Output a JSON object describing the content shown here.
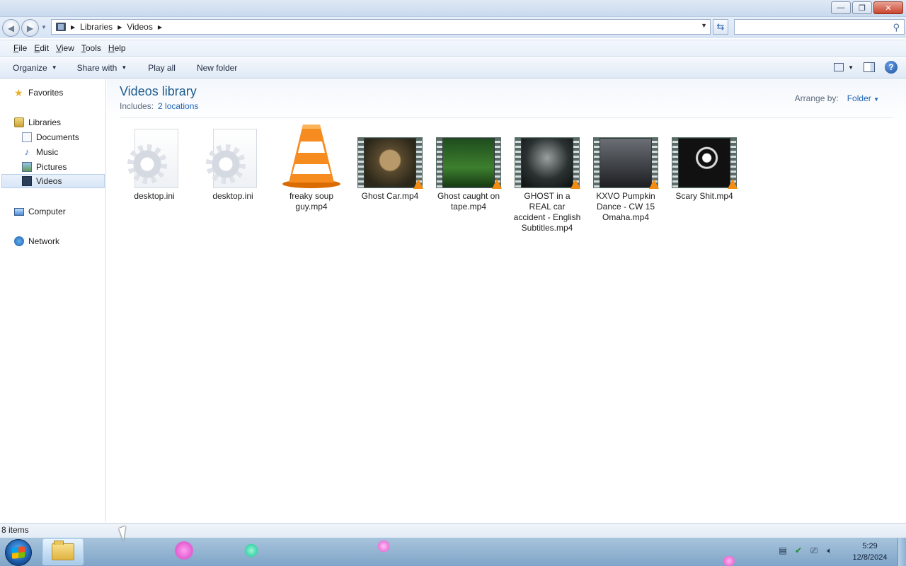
{
  "titlebar": {
    "min_glyph": "—",
    "max_glyph": "❐",
    "close_glyph": "✕"
  },
  "address": {
    "crumbs": [
      "Libraries",
      "Videos"
    ],
    "search_placeholder": ""
  },
  "menu": {
    "items": [
      {
        "underline": "F",
        "rest": "ile"
      },
      {
        "underline": "E",
        "rest": "dit"
      },
      {
        "underline": "V",
        "rest": "iew"
      },
      {
        "underline": "T",
        "rest": "ools"
      },
      {
        "underline": "H",
        "rest": "elp"
      }
    ]
  },
  "toolbar": {
    "organize": "Organize",
    "share_with": "Share with",
    "play_all": "Play all",
    "new_folder": "New folder",
    "help_glyph": "?"
  },
  "nav": {
    "favorites": "Favorites",
    "libraries": "Libraries",
    "documents": "Documents",
    "music": "Music",
    "pictures": "Pictures",
    "videos": "Videos",
    "computer": "Computer",
    "network": "Network"
  },
  "library": {
    "title": "Videos library",
    "includes_label": "Includes:",
    "locations_link": "2 locations",
    "arrange_label": "Arrange by:",
    "arrange_value": "Folder"
  },
  "files": [
    {
      "name": "desktop.ini",
      "kind": "settings-file"
    },
    {
      "name": "desktop.ini",
      "kind": "settings-file"
    },
    {
      "name": "freaky soup guy.mp4",
      "kind": "vlc-cone"
    },
    {
      "name": "Ghost Car.mp4",
      "kind": "video-thumbnail"
    },
    {
      "name": "Ghost caught on tape.mp4",
      "kind": "video-thumbnail"
    },
    {
      "name": "GHOST in a REAL car accident - English Subtitles.mp4",
      "kind": "video-thumbnail"
    },
    {
      "name": "KXVO Pumpkin Dance - CW 15 Omaha.mp4",
      "kind": "video-thumbnail"
    },
    {
      "name": "Scary Shit.mp4",
      "kind": "video-thumbnail"
    }
  ],
  "status": {
    "items_count": "8 items"
  },
  "taskbar": {
    "time": "5:29",
    "date": "12/8/2024"
  },
  "colors": {
    "library_title": "#1e5b8c",
    "link": "#1d63b4",
    "vlc_orange": "#f28c12"
  }
}
